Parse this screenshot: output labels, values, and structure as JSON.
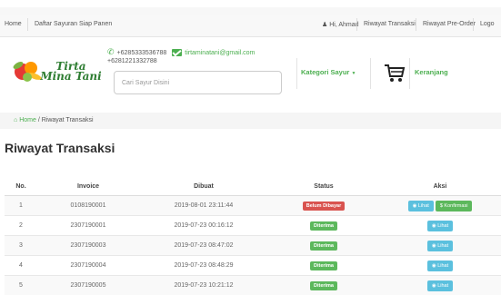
{
  "topnav": {
    "home": "Home",
    "daftar": "Daftar Sayuran Siap Panen",
    "user": "Hi, Ahmad",
    "riwayat_transaksi": "Riwayat Transaksi",
    "riwayat_preorder": "Riwayat Pre-Order",
    "logout": "Logo"
  },
  "header": {
    "logo_text": "Tirta Mina Tani",
    "phone": "+6285333536788",
    "email": "tirtaminatani@gmail.com",
    "phone2": "+6281221332788",
    "search_placeholder": "Cari Sayur Disini",
    "kategori": "Kategori Sayur",
    "keranjang": "Keranjang"
  },
  "breadcrumb": {
    "home": "Home",
    "current": "Riwayat Transaksi"
  },
  "page_title": "Riwayat Transaksi",
  "table": {
    "headers": [
      "No.",
      "Invoice",
      "Dibuat",
      "Status",
      "Aksi"
    ],
    "rows": [
      {
        "no": "1",
        "invoice": "0108190001",
        "dibuat": "2019-08-01 23:11:44",
        "status": "Belum Dibayar",
        "status_color": "#d9534f",
        "lihat": "Lihat",
        "konfirmasi": "$ Konfirmasi"
      },
      {
        "no": "2",
        "invoice": "2307190001",
        "dibuat": "2019-07-23 00:16:12",
        "status": "Diterima",
        "status_color": "#5cb85c",
        "lihat": "Lihat"
      },
      {
        "no": "3",
        "invoice": "2307190003",
        "dibuat": "2019-07-23 08:47:02",
        "status": "Diterima",
        "status_color": "#5cb85c",
        "lihat": "Lihat"
      },
      {
        "no": "4",
        "invoice": "2307190004",
        "dibuat": "2019-07-23 08:48:29",
        "status": "Diterima",
        "status_color": "#5cb85c",
        "lihat": "Lihat"
      },
      {
        "no": "5",
        "invoice": "2307190005",
        "dibuat": "2019-07-23 10:21:12",
        "status": "Diterima",
        "status_color": "#5cb85c",
        "lihat": "Lihat"
      }
    ]
  }
}
